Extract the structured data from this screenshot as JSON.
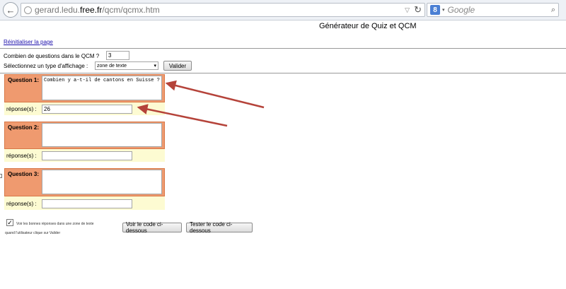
{
  "browser": {
    "back_icon": "back-arrow-icon",
    "url_prefix": "gerard.ledu.",
    "url_domain": "free.fr",
    "url_suffix": "/qcm/qcmx.htm",
    "search_engine_letter": "8",
    "search_placeholder": "Google"
  },
  "page": {
    "title": "Générateur de Quiz et QCM",
    "reset_link": "Réinitialiser la page",
    "question_count_label": "Combien de questions dans le QCM ?",
    "question_count_value": "3",
    "display_type_label": "Sélectionnez un type d'affichage :",
    "display_type_value": "zone de texte",
    "validate_button": "Valider"
  },
  "questions": [
    {
      "label": "Question 1:",
      "text": "Combien y a-t-il de cantons en Suisse ?",
      "answer_label": "réponse(s) :",
      "answer": "26"
    },
    {
      "label": "Question 2:",
      "text": "",
      "answer_label": "réponse(s) :",
      "answer": ""
    },
    {
      "label": "Question 3:",
      "text": "",
      "answer_label": "réponse(s) :",
      "answer": ""
    }
  ],
  "footer": {
    "checkbox_checked": true,
    "checkbox_label_line1": "Voir les bonnes réponses dans une zone de texte",
    "checkbox_label_line2": "quand l'utilisateur clique sur Valider",
    "view_code_button": "Voir le code ci-dessous",
    "test_code_button": "Tester le code ci-dessous"
  },
  "colors": {
    "question_box": "#ef9a6f",
    "answer_row": "#fdfbd2",
    "arrow": "#b5433a"
  }
}
